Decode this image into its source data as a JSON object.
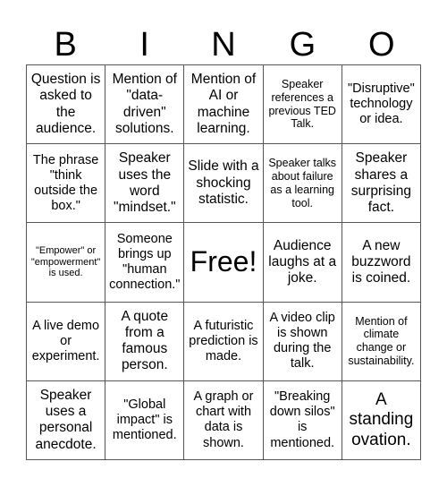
{
  "header": {
    "letters": [
      "B",
      "I",
      "N",
      "G",
      "O"
    ]
  },
  "card": {
    "cells": [
      "Question is asked to the audience.",
      "Mention of \"data-driven\" solutions.",
      "Mention of AI or machine learning.",
      "Speaker references a previous TED Talk.",
      "\"Disruptive\" technology or idea.",
      "The phrase \"think outside the box.\"",
      "Speaker uses the word \"mindset.\"",
      "Slide with a shocking statistic.",
      "Speaker talks about failure as a learning tool.",
      "Speaker shares a surprising fact.",
      "\"Empower\" or \"empowerment\" is used.",
      "Someone brings up \"human connection.\"",
      "Free!",
      "Audience laughs at a joke.",
      "A new buzzword is coined.",
      "A live demo or experiment.",
      "A quote from a famous person.",
      "A futuristic prediction is made.",
      "A video clip is shown during the talk.",
      "Mention of climate change or sustainability.",
      "Speaker uses a personal anecdote.",
      "\"Global impact\" is mentioned.",
      "A graph or chart with data is shown.",
      "\"Breaking down silos\" is mentioned.",
      "A standing ovation."
    ]
  }
}
